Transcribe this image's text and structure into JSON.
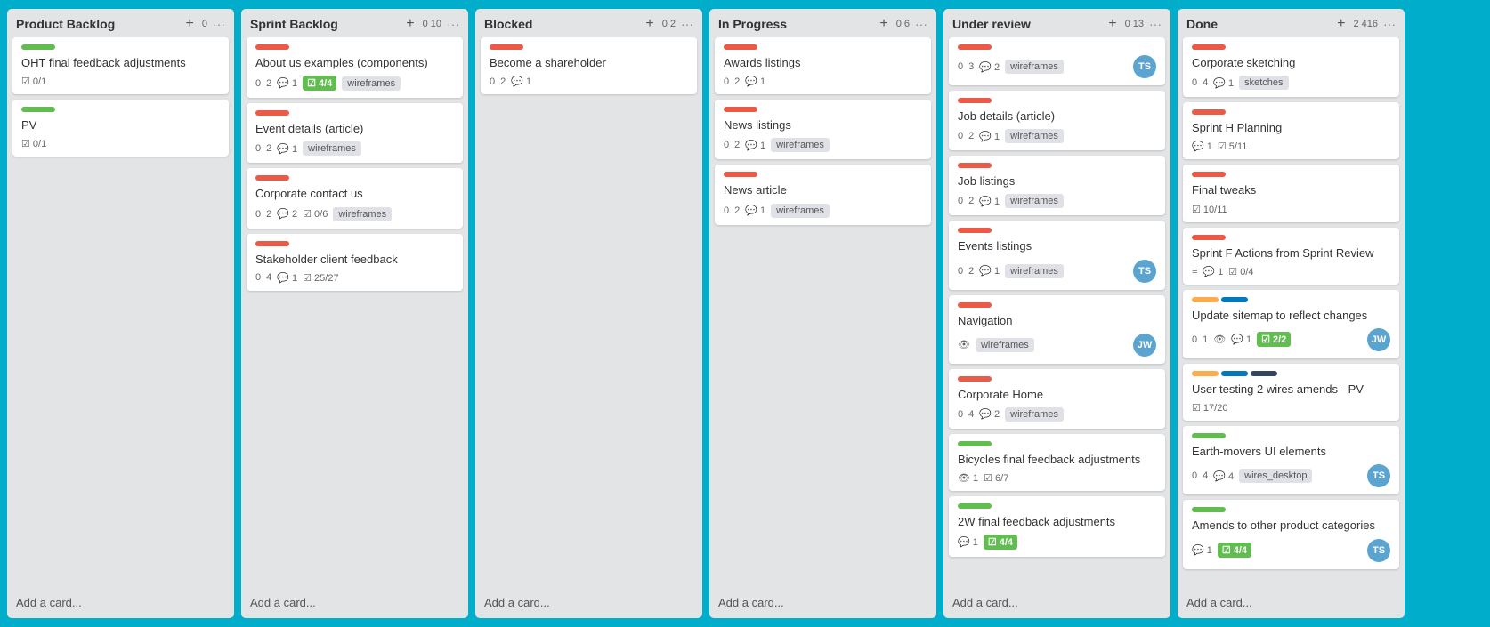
{
  "board": {
    "columns": [
      {
        "id": "product-backlog",
        "title": "Product Backlog",
        "add_label": "+",
        "count_a": "0",
        "count_b": "",
        "menu": "···",
        "cards": [
          {
            "id": "card-oht",
            "label_color": "label-green",
            "title": "OHT final feedback adjustments",
            "meta": [
              {
                "type": "check",
                "text": "0/1"
              }
            ]
          },
          {
            "id": "card-pv",
            "label_color": "label-green",
            "title": "PV",
            "meta": [
              {
                "type": "check",
                "text": "0/1"
              }
            ]
          }
        ],
        "add_card_text": "Add a card..."
      },
      {
        "id": "sprint-backlog",
        "title": "Sprint Backlog",
        "add_label": "+",
        "count_a": "0",
        "count_b": "10",
        "menu": "···",
        "cards": [
          {
            "id": "card-about-us",
            "label_color": "label-red",
            "title": "About us examples (components)",
            "meta": [
              {
                "type": "num",
                "text": "0"
              },
              {
                "type": "num",
                "text": "2"
              },
              {
                "type": "comment",
                "text": "1"
              },
              {
                "type": "badge",
                "text": "4/4"
              },
              {
                "type": "tag",
                "text": "wireframes"
              }
            ]
          },
          {
            "id": "card-event-details",
            "label_color": "label-red",
            "title": "Event details (article)",
            "meta": [
              {
                "type": "num",
                "text": "0"
              },
              {
                "type": "num",
                "text": "2"
              },
              {
                "type": "comment",
                "text": "1"
              },
              {
                "type": "tag",
                "text": "wireframes"
              }
            ]
          },
          {
            "id": "card-corporate-contact",
            "label_color": "label-red",
            "title": "Corporate contact us",
            "meta": [
              {
                "type": "num",
                "text": "0"
              },
              {
                "type": "num",
                "text": "2"
              },
              {
                "type": "comment",
                "text": "2"
              },
              {
                "type": "check-plain",
                "text": "0/6"
              },
              {
                "type": "tag",
                "text": "wireframes"
              }
            ]
          },
          {
            "id": "card-stakeholder",
            "label_color": "label-red",
            "title": "Stakeholder client feedback",
            "meta": [
              {
                "type": "num",
                "text": "0"
              },
              {
                "type": "num",
                "text": "4"
              },
              {
                "type": "comment",
                "text": "1"
              },
              {
                "type": "check-plain",
                "text": "25/27"
              }
            ]
          }
        ],
        "add_card_text": "Add a card..."
      },
      {
        "id": "blocked",
        "title": "Blocked",
        "add_label": "+",
        "count_a": "0",
        "count_b": "2",
        "menu": "···",
        "cards": [
          {
            "id": "card-shareholder",
            "label_color": "label-red",
            "title": "Become a shareholder",
            "meta": [
              {
                "type": "num",
                "text": "0"
              },
              {
                "type": "num",
                "text": "2"
              },
              {
                "type": "comment",
                "text": "1"
              }
            ]
          }
        ],
        "add_card_text": "Add a card..."
      },
      {
        "id": "in-progress",
        "title": "In Progress",
        "add_label": "+",
        "count_a": "0",
        "count_b": "6",
        "menu": "···",
        "cards": [
          {
            "id": "card-awards",
            "label_color": "label-red",
            "title": "Awards listings",
            "meta": [
              {
                "type": "num",
                "text": "0"
              },
              {
                "type": "num",
                "text": "2"
              },
              {
                "type": "comment",
                "text": "1"
              }
            ]
          },
          {
            "id": "card-news-listings",
            "label_color": "label-red",
            "title": "News listings",
            "meta": [
              {
                "type": "num",
                "text": "0"
              },
              {
                "type": "num",
                "text": "2"
              },
              {
                "type": "comment",
                "text": "1"
              },
              {
                "type": "tag",
                "text": "wireframes"
              }
            ]
          },
          {
            "id": "card-news-article",
            "label_color": "label-red",
            "title": "News article",
            "meta": [
              {
                "type": "num",
                "text": "0"
              },
              {
                "type": "num",
                "text": "2"
              },
              {
                "type": "comment",
                "text": "1"
              },
              {
                "type": "tag",
                "text": "wireframes"
              }
            ]
          }
        ],
        "add_card_text": "Add a card..."
      },
      {
        "id": "under-review",
        "title": "Under review",
        "add_label": "+",
        "count_a": "0",
        "count_b": "13",
        "menu": "···",
        "cards": [
          {
            "id": "card-ur-top",
            "label_color": "label-red",
            "title": "",
            "meta": [
              {
                "type": "num",
                "text": "0"
              },
              {
                "type": "num",
                "text": "3"
              },
              {
                "type": "comment",
                "text": "2"
              },
              {
                "type": "tag",
                "text": "wireframes"
              }
            ],
            "avatar": "TS"
          },
          {
            "id": "card-job-details",
            "label_color": "label-red",
            "title": "Job details (article)",
            "meta": [
              {
                "type": "num",
                "text": "0"
              },
              {
                "type": "num",
                "text": "2"
              },
              {
                "type": "comment",
                "text": "1"
              },
              {
                "type": "tag",
                "text": "wireframes"
              }
            ]
          },
          {
            "id": "card-job-listings",
            "label_color": "label-red",
            "title": "Job listings",
            "meta": [
              {
                "type": "num",
                "text": "0"
              },
              {
                "type": "num",
                "text": "2"
              },
              {
                "type": "comment",
                "text": "1"
              },
              {
                "type": "tag",
                "text": "wireframes"
              }
            ]
          },
          {
            "id": "card-events-listings",
            "label_color": "label-red",
            "title": "Events listings",
            "meta": [
              {
                "type": "num",
                "text": "0"
              },
              {
                "type": "num",
                "text": "2"
              },
              {
                "type": "comment",
                "text": "1"
              },
              {
                "type": "tag",
                "text": "wireframes"
              }
            ],
            "avatar": "TS"
          },
          {
            "id": "card-navigation",
            "label_color": "label-red",
            "title": "Navigation",
            "meta": [
              {
                "type": "eye",
                "text": ""
              },
              {
                "type": "tag",
                "text": "wireframes"
              }
            ],
            "avatar": "JW"
          },
          {
            "id": "card-corporate-home",
            "label_color": "label-red",
            "title": "Corporate Home",
            "meta": [
              {
                "type": "num",
                "text": "0"
              },
              {
                "type": "num",
                "text": "4"
              },
              {
                "type": "comment",
                "text": "2"
              },
              {
                "type": "tag",
                "text": "wireframes"
              }
            ]
          },
          {
            "id": "card-bicycles",
            "label_color": "label-green",
            "title": "Bicycles final feedback adjustments",
            "meta": [
              {
                "type": "eye",
                "text": "1"
              },
              {
                "type": "check-plain",
                "text": "6/7"
              }
            ]
          },
          {
            "id": "card-2w",
            "label_color": "label-green",
            "title": "2W final feedback adjustments",
            "meta": [
              {
                "type": "comment",
                "text": "1"
              },
              {
                "type": "badge",
                "text": "4/4"
              }
            ]
          }
        ],
        "add_card_text": "Add a card..."
      },
      {
        "id": "done",
        "title": "Done",
        "add_label": "+",
        "count_a": "2",
        "count_b": "416",
        "menu": "···",
        "cards": [
          {
            "id": "card-corporate-sketching",
            "label_color": "label-red",
            "title": "Corporate sketching",
            "meta": [
              {
                "type": "num",
                "text": "0"
              },
              {
                "type": "num",
                "text": "4"
              },
              {
                "type": "comment",
                "text": "1"
              },
              {
                "type": "tag",
                "text": "sketches"
              }
            ]
          },
          {
            "id": "card-sprint-h",
            "label_color": "label-red",
            "title": "Sprint H Planning",
            "meta": [
              {
                "type": "comment",
                "text": "1"
              },
              {
                "type": "check-plain",
                "text": "5/11"
              }
            ]
          },
          {
            "id": "card-final-tweaks",
            "label_color": "label-red",
            "title": "Final tweaks",
            "meta": [
              {
                "type": "check-plain",
                "text": "10/11"
              }
            ]
          },
          {
            "id": "card-sprint-f",
            "label_color": "label-red",
            "title": "Sprint F Actions from Sprint Review",
            "meta": [
              {
                "type": "lines",
                "text": ""
              },
              {
                "type": "comment",
                "text": "1"
              },
              {
                "type": "check-plain",
                "text": "0/4"
              }
            ]
          },
          {
            "id": "card-sitemap",
            "label_color": "label-multi",
            "labels": [
              "label-orange",
              "label-blue"
            ],
            "title": "Update sitemap to reflect changes",
            "meta": [
              {
                "type": "num",
                "text": "0"
              },
              {
                "type": "num",
                "text": "1"
              },
              {
                "type": "eye",
                "text": ""
              },
              {
                "type": "comment",
                "text": "1"
              },
              {
                "type": "badge",
                "text": "2/2"
              }
            ],
            "avatar": "JW"
          },
          {
            "id": "card-user-testing",
            "label_color": "label-multi",
            "labels": [
              "label-orange",
              "label-blue",
              "label-dark"
            ],
            "title": "User testing 2 wires amends - PV",
            "meta": [
              {
                "type": "check-plain",
                "text": "17/20"
              }
            ]
          },
          {
            "id": "card-earth-movers",
            "label_color": "label-green",
            "title": "Earth-movers UI elements",
            "meta": [
              {
                "type": "num",
                "text": "0"
              },
              {
                "type": "num",
                "text": "4"
              },
              {
                "type": "comment",
                "text": "4"
              },
              {
                "type": "tag",
                "text": "wires_desktop"
              }
            ],
            "avatar": "TS"
          },
          {
            "id": "card-amends",
            "label_color": "label-green",
            "title": "Amends to other product categories",
            "meta": [
              {
                "type": "comment",
                "text": "1"
              },
              {
                "type": "badge",
                "text": "4/4"
              }
            ],
            "avatar": "TS"
          }
        ],
        "add_card_text": "Add a card..."
      }
    ]
  }
}
